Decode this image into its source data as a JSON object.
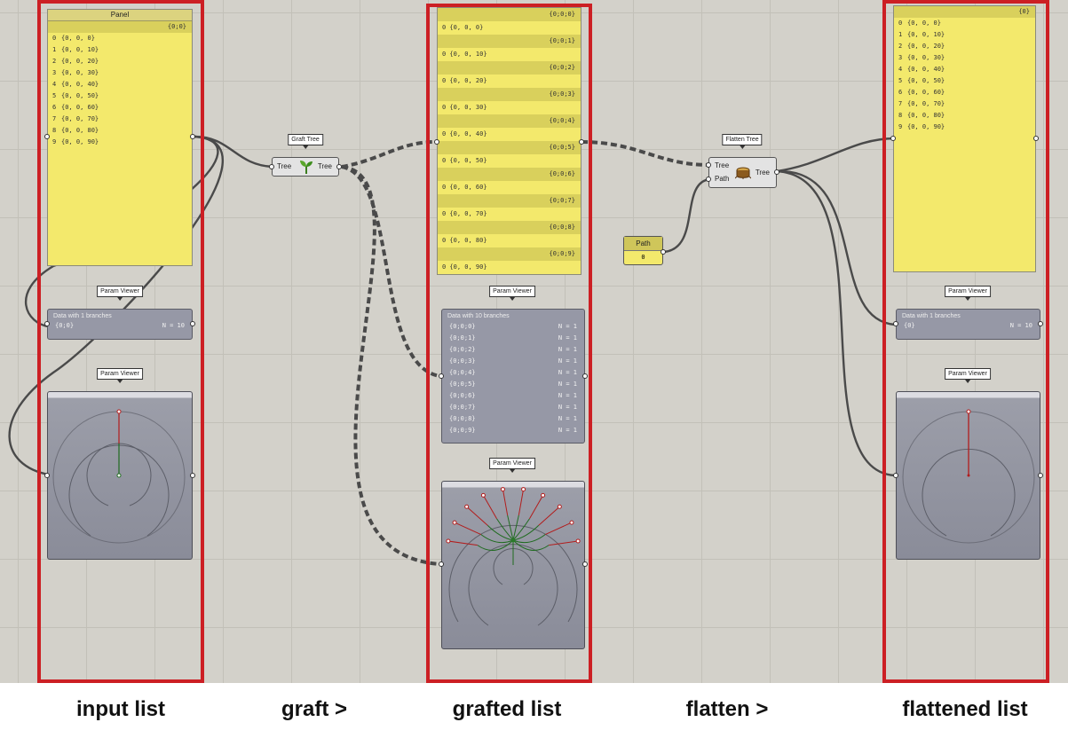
{
  "input_panel": {
    "title": "Panel",
    "path": "{0;0}",
    "rows": [
      {
        "i": "0",
        "v": "{0, 0, 0}"
      },
      {
        "i": "1",
        "v": "{0, 0, 10}"
      },
      {
        "i": "2",
        "v": "{0, 0, 20}"
      },
      {
        "i": "3",
        "v": "{0, 0, 30}"
      },
      {
        "i": "4",
        "v": "{0, 0, 40}"
      },
      {
        "i": "5",
        "v": "{0, 0, 50}"
      },
      {
        "i": "6",
        "v": "{0, 0, 60}"
      },
      {
        "i": "7",
        "v": "{0, 0, 70}"
      },
      {
        "i": "8",
        "v": "{0, 0, 80}"
      },
      {
        "i": "9",
        "v": "{0, 0, 90}"
      }
    ]
  },
  "grafted_panel": {
    "branches": [
      {
        "path": "{0;0;0}",
        "row": "0 {0, 0, 0}"
      },
      {
        "path": "{0;0;1}",
        "row": "0 {0, 0, 10}"
      },
      {
        "path": "{0;0;2}",
        "row": "0 {0, 0, 20}"
      },
      {
        "path": "{0;0;3}",
        "row": "0 {0, 0, 30}"
      },
      {
        "path": "{0;0;4}",
        "row": "0 {0, 0, 40}"
      },
      {
        "path": "{0;0;5}",
        "row": "0 {0, 0, 50}"
      },
      {
        "path": "{0;0;6}",
        "row": "0 {0, 0, 60}"
      },
      {
        "path": "{0;0;7}",
        "row": "0 {0, 0, 70}"
      },
      {
        "path": "{0;0;8}",
        "row": "0 {0, 0, 80}"
      },
      {
        "path": "{0;0;9}",
        "row": "0 {0, 0, 90}"
      }
    ]
  },
  "flattened_panel": {
    "path": "{0}",
    "rows": [
      {
        "i": "0",
        "v": "{0, 0, 0}"
      },
      {
        "i": "1",
        "v": "{0, 0, 10}"
      },
      {
        "i": "2",
        "v": "{0, 0, 20}"
      },
      {
        "i": "3",
        "v": "{0, 0, 30}"
      },
      {
        "i": "4",
        "v": "{0, 0, 40}"
      },
      {
        "i": "5",
        "v": "{0, 0, 50}"
      },
      {
        "i": "6",
        "v": "{0, 0, 60}"
      },
      {
        "i": "7",
        "v": "{0, 0, 70}"
      },
      {
        "i": "8",
        "v": "{0, 0, 80}"
      },
      {
        "i": "9",
        "v": "{0, 0, 90}"
      }
    ]
  },
  "param_viewer_label": "Param Viewer",
  "viewer_input": {
    "title": "Data with 1 branches",
    "path": "{0;0}",
    "count": "N = 10"
  },
  "viewer_grafted": {
    "title": "Data with 10 branches",
    "rows": [
      {
        "path": "{0;0;0}",
        "count": "N = 1"
      },
      {
        "path": "{0;0;1}",
        "count": "N = 1"
      },
      {
        "path": "{0;0;2}",
        "count": "N = 1"
      },
      {
        "path": "{0;0;3}",
        "count": "N = 1"
      },
      {
        "path": "{0;0;4}",
        "count": "N = 1"
      },
      {
        "path": "{0;0;5}",
        "count": "N = 1"
      },
      {
        "path": "{0;0;6}",
        "count": "N = 1"
      },
      {
        "path": "{0;0;7}",
        "count": "N = 1"
      },
      {
        "path": "{0;0;8}",
        "count": "N = 1"
      },
      {
        "path": "{0;0;9}",
        "count": "N = 1"
      }
    ]
  },
  "viewer_flattened": {
    "title": "Data with 1 branches",
    "path": "{0}",
    "count": "N = 10"
  },
  "graft_component": {
    "tag": "Graft Tree",
    "input": "Tree",
    "output": "Tree"
  },
  "flatten_component": {
    "tag": "Flatten Tree",
    "input_tree": "Tree",
    "input_path": "Path",
    "output": "Tree"
  },
  "path_param": {
    "title": "Path",
    "value": "0"
  },
  "captions": {
    "input": "input list",
    "graft": "graft >",
    "grafted": "grafted list",
    "flatten": "flatten >",
    "flattened": "flattened list"
  },
  "colors": {
    "highlight_box": "#cc1f24",
    "panel_yellow": "#f3e96c",
    "canvas": "#d3d1ca",
    "viewer": "#9698a6"
  }
}
